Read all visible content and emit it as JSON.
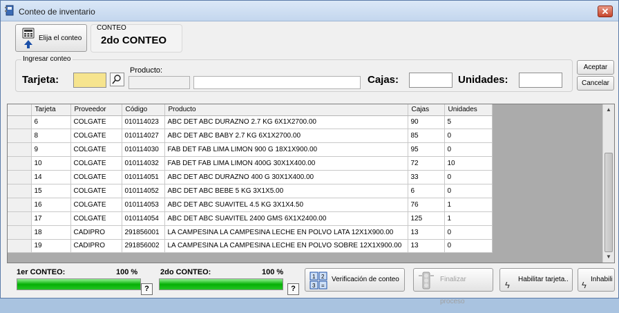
{
  "window": {
    "title": "Conteo de inventario",
    "close_label": "✕"
  },
  "toolbar": {
    "elija_label": "Elija el conteo"
  },
  "conteo": {
    "caption": "CONTEO",
    "value": "2do CONTEO"
  },
  "ingreso": {
    "legend": "Ingresar conteo",
    "tarjeta_label": "Tarjeta:",
    "producto_label": "Producto:",
    "cajas_label": "Cajas:",
    "unidades_label": "Unidades:"
  },
  "dialog": {
    "aceptar": "Aceptar",
    "cancelar": "Cancelar"
  },
  "table": {
    "columns": [
      "Tarjeta",
      "Proveedor",
      "Código",
      "Producto",
      "Cajas",
      "Unidades"
    ],
    "rows": [
      [
        "6",
        "COLGATE",
        "010114023",
        "ABC DET ABC DURAZNO 2.7 KG 6X1X2700.00",
        "90",
        "5"
      ],
      [
        "8",
        "COLGATE",
        "010114027",
        "ABC DET ABC BABY 2.7 KG 6X1X2700.00",
        "85",
        "0"
      ],
      [
        "9",
        "COLGATE",
        "010114030",
        "FAB DET FAB LIMA LIMON 900 G 18X1X900.00",
        "95",
        "0"
      ],
      [
        "10",
        "COLGATE",
        "010114032",
        "FAB DET FAB LIMA LIMON 400G 30X1X400.00",
        "72",
        "10"
      ],
      [
        "14",
        "COLGATE",
        "010114051",
        "ABC DET ABC DURAZNO 400 G 30X1X400.00",
        "33",
        "0"
      ],
      [
        "15",
        "COLGATE",
        "010114052",
        "ABC DET ABC BEBE 5 KG 3X1X5.00",
        "6",
        "0"
      ],
      [
        "16",
        "COLGATE",
        "010114053",
        "ABC DET ABC SUAVITEL 4.5 KG 3X1X4.50",
        "76",
        "1"
      ],
      [
        "17",
        "COLGATE",
        "010114054",
        "ABC DET ABC SUAVITEL 2400 GMS 6X1X2400.00",
        "125",
        "1"
      ],
      [
        "18",
        "CADIPRO",
        "291856001",
        "LA CAMPESINA LA CAMPESINA LECHE EN POLVO LATA 12X1X900.00",
        "13",
        "0"
      ],
      [
        "19",
        "CADIPRO",
        "291856002",
        "LA CAMPESINA LA CAMPESINA LECHE EN POLVO SOBRE 12X1X900.00",
        "13",
        "0"
      ]
    ]
  },
  "progress": {
    "first_label": "1er CONTEO:",
    "first_pct": "100 %",
    "first_value": 100,
    "second_label": "2do CONTEO:",
    "second_pct": "100 %",
    "second_value": 100,
    "help_glyph": "?"
  },
  "actions": {
    "verificacion": "Verificación de conteo",
    "finalizar": "Finalizar proceso",
    "habilitar": "Habilitar tarjeta..",
    "inhabilitar": "Inhabili",
    "bolt_glyph": "ϟ"
  },
  "colors": {
    "progress_fill": "#06b006",
    "tarjeta_field": "#f6e48e",
    "accent": "#1a4fa8"
  },
  "icons": [
    "notebook-icon",
    "calculator-icon",
    "search-icon",
    "help-icon",
    "bolt-icon",
    "traffic-light-icon",
    "verification-grid-icon",
    "scroll-up-icon",
    "scroll-down-icon"
  ]
}
